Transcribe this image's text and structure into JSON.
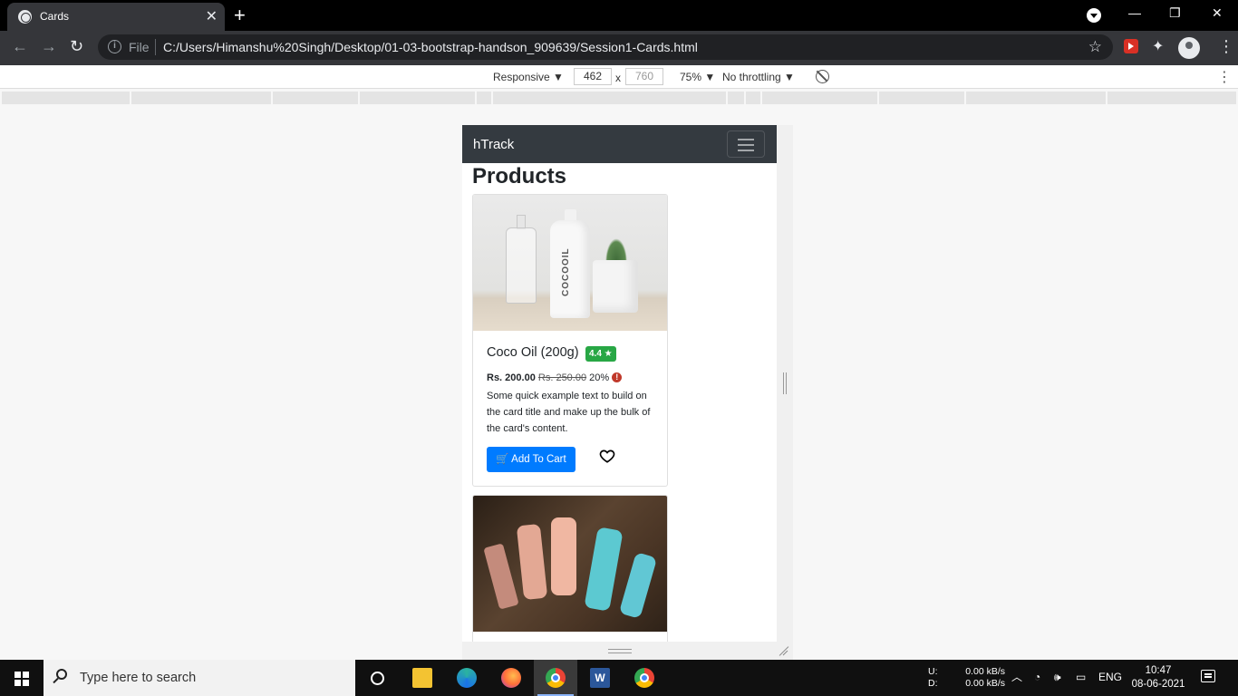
{
  "browser": {
    "tab_title": "Cards",
    "close_glyph": "✕",
    "new_tab_glyph": "+",
    "omnibox_prefix": "File",
    "url": "C:/Users/Himanshu%20Singh/Desktop/01-03-bootstrap-handson_909639/Session1-Cards.html"
  },
  "devtools": {
    "device": "Responsive ▼",
    "width": "462",
    "height": "760",
    "times": "x",
    "zoom": "75% ▼",
    "throttling": "No throttling ▼"
  },
  "page": {
    "brand": "hTrack",
    "heading": "Products",
    "cards": [
      {
        "title": "Coco Oil (200g)",
        "rating": "4.4 ★",
        "price": "Rs. 200.00",
        "old_price": "Rs. 250.00",
        "discount": "20%",
        "alert_glyph": "!",
        "label_on_bottle": "COCOOIL",
        "description": "Some quick example text to build on the card title and make up the bulk of the card's content.",
        "button": "🛒 Add To Cart"
      }
    ]
  },
  "taskbar": {
    "search_placeholder": "Type here to search",
    "word_glyph": "W",
    "net_labels": "U:\nD:",
    "net_up": "0.00 kB/s",
    "net_down": "0.00 kB/s",
    "lang": "ENG",
    "time": "10:47",
    "date": "08-06-2021"
  },
  "colors": {
    "navbar_bg": "#343a40",
    "primary": "#007bff",
    "success": "#28a745",
    "browser_dark": "#35363a"
  },
  "icons": [
    "globe-icon",
    "back-arrow-icon",
    "forward-arrow-icon",
    "reload-icon",
    "info-icon",
    "star-icon",
    "extension-puzzle-icon",
    "profile-icon",
    "kebab-menu-icon",
    "rotate-icon",
    "hamburger-icon",
    "cart-icon",
    "heart-icon",
    "alert-icon",
    "windows-start-icon",
    "search-icon",
    "cortana-icon",
    "notification-icon"
  ]
}
